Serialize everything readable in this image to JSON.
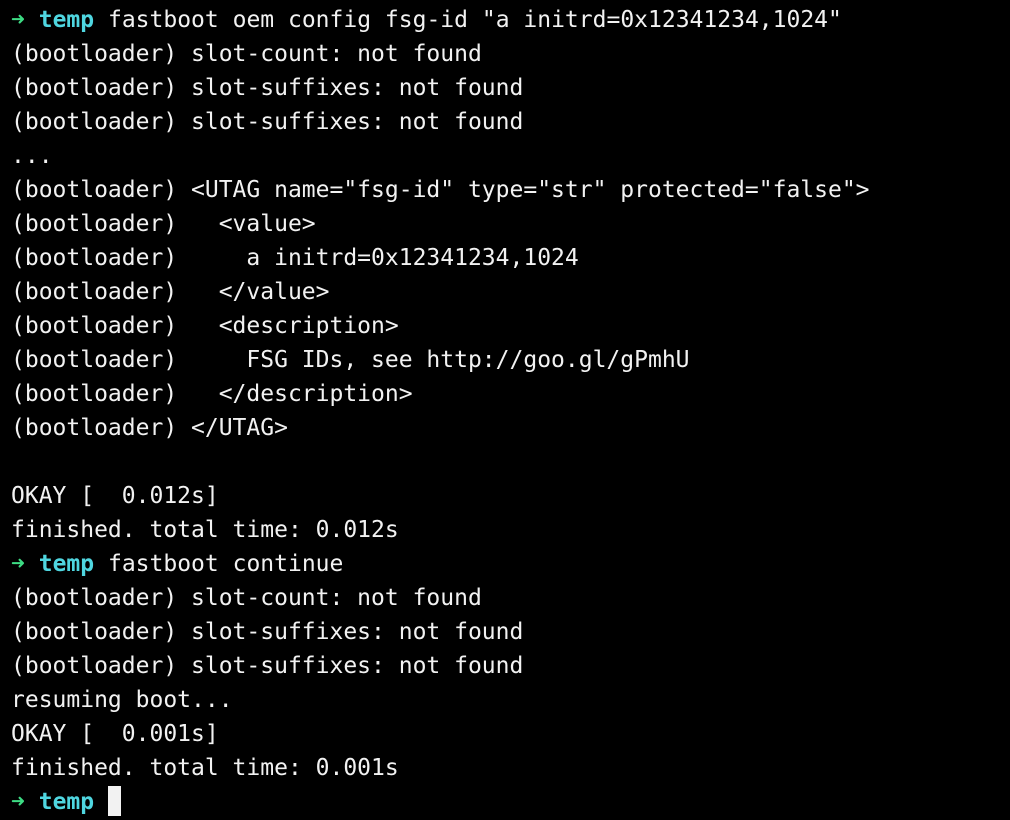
{
  "terminal": {
    "colors": {
      "background": "#000000",
      "text": "#f2f2f2",
      "prompt_arrow": "#3ddc84",
      "prompt_dir": "#4fd6e0"
    },
    "prompt": {
      "arrow_icon": "right-arrow-icon",
      "arrow": "➜",
      "dir": "temp"
    },
    "commands": {
      "cmd1": "fastboot oem config fsg-id \"a initrd=0x12341234,1024\"",
      "cmd2": "fastboot continue"
    },
    "output": {
      "o1": "(bootloader) slot-count: not found",
      "o2": "(bootloader) slot-suffixes: not found",
      "o3": "(bootloader) slot-suffixes: not found",
      "o4": "...",
      "o5": "(bootloader) <UTAG name=\"fsg-id\" type=\"str\" protected=\"false\">",
      "o6": "(bootloader)   <value>",
      "o7": "(bootloader)     a initrd=0x12341234,1024",
      "o8": "(bootloader)   </value>",
      "o9": "(bootloader)   <description>",
      "o10": "(bootloader)     FSG IDs, see http://goo.gl/gPmhU",
      "o11": "(bootloader)   </description>",
      "o12": "(bootloader) </UTAG>",
      "o13": "",
      "o14": "OKAY [  0.012s]",
      "o15": "finished. total time: 0.012s",
      "o16": "(bootloader) slot-count: not found",
      "o17": "(bootloader) slot-suffixes: not found",
      "o18": "(bootloader) slot-suffixes: not found",
      "o19": "resuming boot...",
      "o20": "OKAY [  0.001s]",
      "o21": "finished. total time: 0.001s"
    }
  }
}
